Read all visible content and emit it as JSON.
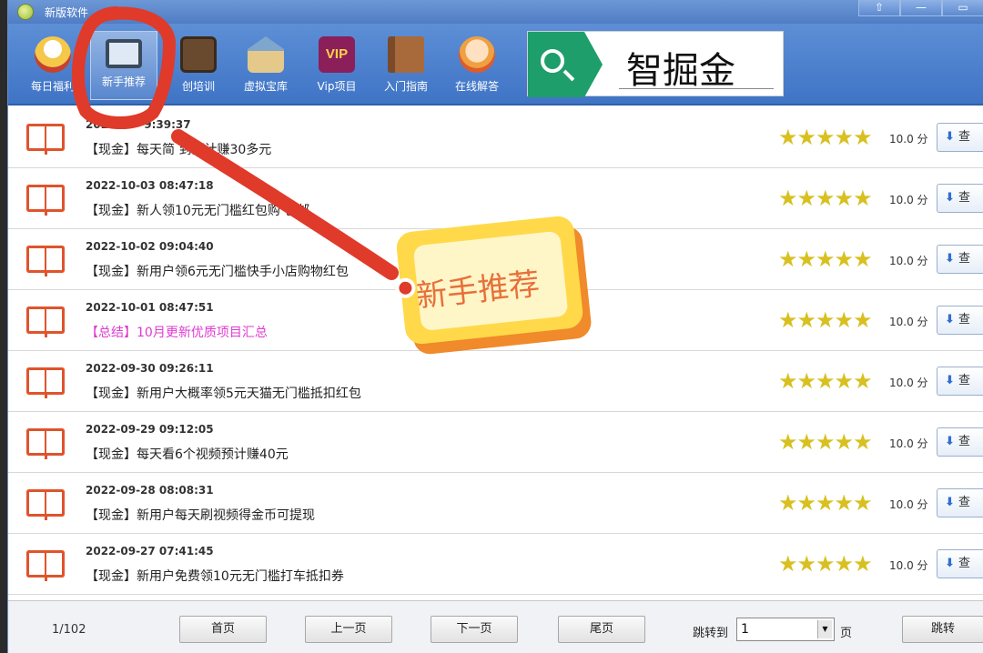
{
  "window": {
    "title": "新版软件",
    "controls": [
      "⇧",
      "—",
      "▭"
    ]
  },
  "toolbar": {
    "items": [
      {
        "label": "每日福利",
        "icon": "lucky-cat-icon"
      },
      {
        "label": "新手推荐",
        "icon": "monitor-icon",
        "active": true
      },
      {
        "label": "创培训",
        "icon": "easel-icon"
      },
      {
        "label": "虚拟宝库",
        "icon": "warehouse-icon"
      },
      {
        "label": "Vip项目",
        "icon": "vip-icon"
      },
      {
        "label": "入门指南",
        "icon": "book-icon"
      },
      {
        "label": "在线解答",
        "icon": "support-icon"
      }
    ],
    "vip_badge": "VIP"
  },
  "search_badge": {
    "text": "智掘金",
    "icon": "search-icon"
  },
  "list": {
    "rows": [
      {
        "date": "2022-10-   9:39:37",
        "title": "【现金】每天简     到预计赚30多元",
        "pink": false,
        "score": "10.0 分",
        "button": "查"
      },
      {
        "date": "2022-10-03 08:47:18",
        "title": "【现金】新人领10元无门槛红包购    包邮",
        "pink": false,
        "score": "10.0 分",
        "button": "查"
      },
      {
        "date": "2022-10-02 09:04:40",
        "title": "【现金】新用户领6元无门槛快手小店购物红包",
        "pink": false,
        "score": "10.0 分",
        "button": "查"
      },
      {
        "date": "2022-10-01 08:47:51",
        "title": "【总结】10月更新优质项目汇总",
        "pink": true,
        "score": "10.0 分",
        "button": "查"
      },
      {
        "date": "2022-09-30 09:26:11",
        "title": "【现金】新用户大概率领5元天猫无门槛抵扣红包",
        "pink": false,
        "score": "10.0 分",
        "button": "查"
      },
      {
        "date": "2022-09-29 09:12:05",
        "title": "【现金】每天看6个视频预计赚40元",
        "pink": false,
        "score": "10.0 分",
        "button": "查"
      },
      {
        "date": "2022-09-28 08:08:31",
        "title": "【现金】新用户每天刷视频得金币可提现",
        "pink": false,
        "score": "10.0 分",
        "button": "查"
      },
      {
        "date": "2022-09-27 07:41:45",
        "title": "【现金】新用户免费领10元无门槛打车抵扣券",
        "pink": false,
        "score": "10.0 分",
        "button": "查"
      }
    ],
    "stars": "★★★★★",
    "colors": {
      "title_pink": "#e03ad0",
      "book_orange": "#e0532b",
      "star_gold": "#d8c020"
    }
  },
  "pager": {
    "info": "1/102",
    "first": "首页",
    "prev": "上一页",
    "next": "下一页",
    "last": "尾页",
    "jump_label": "跳转到",
    "jump_value": "1",
    "unit": "页",
    "go": "跳转"
  },
  "annotation": {
    "tag_text": "新手推荐",
    "colors": {
      "marker_red": "#e03a2a",
      "tag_yellow": "#ffd94a",
      "tag_orange": "#f08a2a"
    }
  }
}
